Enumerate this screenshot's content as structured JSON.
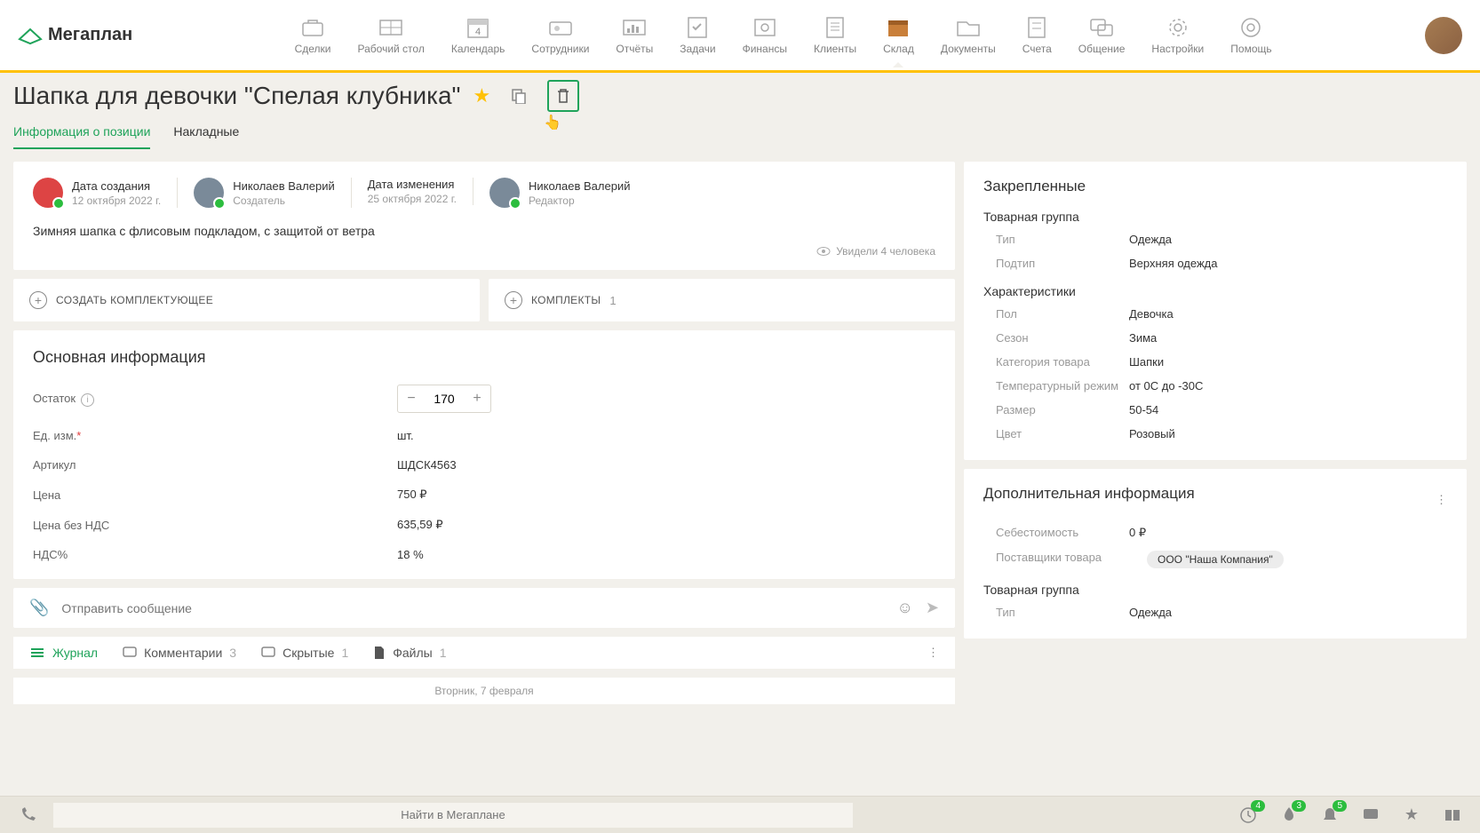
{
  "nav": {
    "logo": "Мегаплан",
    "items": [
      {
        "label": "Сделки"
      },
      {
        "label": "Рабочий стол"
      },
      {
        "label": "Календарь"
      },
      {
        "label": "Сотрудники"
      },
      {
        "label": "Отчёты"
      },
      {
        "label": "Задачи"
      },
      {
        "label": "Финансы"
      },
      {
        "label": "Клиенты"
      },
      {
        "label": "Склад"
      },
      {
        "label": "Документы"
      },
      {
        "label": "Счета"
      },
      {
        "label": "Общение"
      },
      {
        "label": "Настройки"
      },
      {
        "label": "Помощь"
      }
    ]
  },
  "page": {
    "title": "Шапка для девочки \"Спелая клубника\"",
    "tabs": {
      "info": "Информация о позиции",
      "invoices": "Накладные"
    }
  },
  "meta": {
    "created_label": "Дата создания",
    "created_date": "12 октября 2022 г.",
    "creator_name": "Николаев Валерий",
    "creator_role": "Создатель",
    "modified_label": "Дата изменения",
    "modified_date": "25 октября 2022 г.",
    "editor_name": "Николаев Валерий",
    "editor_role": "Редактор",
    "description": "Зимняя шапка с флисовым подкладом, с защитой от ветра",
    "views": "Увидели 4 человека"
  },
  "actions": {
    "create_component": "СОЗДАТЬ КОМПЛЕКТУЮЩЕЕ",
    "bundles": "КОМПЛЕКТЫ",
    "bundles_count": "1"
  },
  "info": {
    "heading": "Основная информация",
    "stock_label": "Остаток",
    "stock_value": "170",
    "unit_label": "Ед. изм.",
    "unit_value": "шт.",
    "sku_label": "Артикул",
    "sku_value": "ШДСК4563",
    "price_label": "Цена",
    "price_value": "750 ₽",
    "price_novat_label": "Цена без НДС",
    "price_novat_value": "635,59 ₽",
    "vat_label": "НДС%",
    "vat_value": "18 %"
  },
  "msg": {
    "placeholder": "Отправить сообщение"
  },
  "log": {
    "journal": "Журнал",
    "comments": "Комментарии",
    "comments_count": "3",
    "hidden": "Скрытые",
    "hidden_count": "1",
    "files": "Файлы",
    "files_count": "1",
    "date": "Вторник, 7 февраля"
  },
  "pinned": {
    "heading": "Закрепленные",
    "group_heading": "Товарная группа",
    "type_label": "Тип",
    "type_value": "Одежда",
    "subtype_label": "Подтип",
    "subtype_value": "Верхняя одежда",
    "chars_heading": "Характеристики",
    "gender_label": "Пол",
    "gender_value": "Девочка",
    "season_label": "Сезон",
    "season_value": "Зима",
    "cat_label": "Категория товара",
    "cat_value": "Шапки",
    "temp_label": "Температурный режим",
    "temp_value": "от 0С до -30С",
    "size_label": "Размер",
    "size_value": "50-54",
    "color_label": "Цвет",
    "color_value": "Розовый"
  },
  "extra": {
    "heading": "Дополнительная информация",
    "cost_label": "Себестоимость",
    "cost_value": "0 ₽",
    "supplier_label": "Поставщики товара",
    "supplier_value": "ООО \"Наша Компания\"",
    "group_heading": "Товарная группа",
    "type_label": "Тип",
    "type_value": "Одежда"
  },
  "bottom": {
    "search_placeholder": "Найти в Мегаплане",
    "badge1": "4",
    "badge2": "3",
    "badge3": "5"
  }
}
